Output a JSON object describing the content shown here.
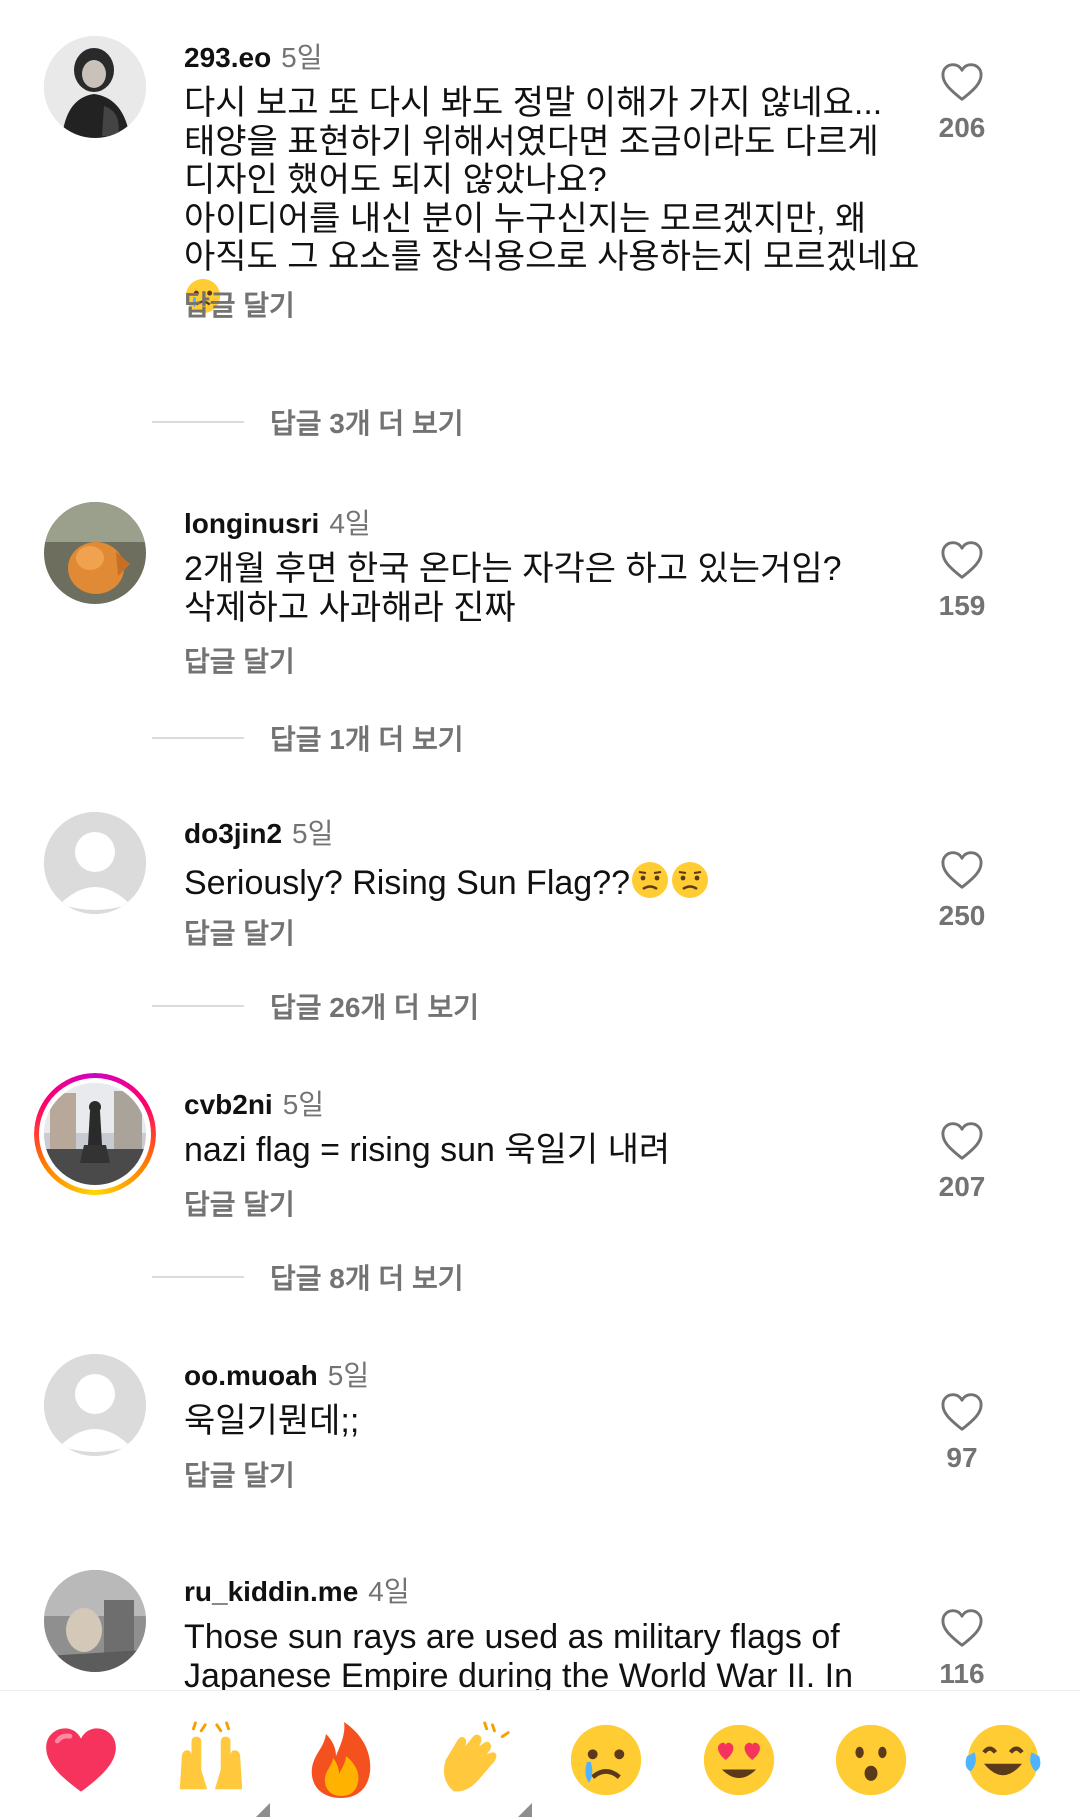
{
  "comments": [
    {
      "username": "293.eo",
      "time": "5일",
      "text": "다시 보고 또 다시 봐도 정말 이해가 가지 않네요...\n태양을 표현하기 위해서였다면 조금이라도 다르게\n디자인 했어도 되지 않았나요?\n아이디어를 내신 분이 누구신지는 모르겠지만, 왜\n아직도 그 요소를 장식용으로 사용하는지 모르겠네요",
      "emoji": "crying-face",
      "reply_label": "답글 달기",
      "likes": "206",
      "more_replies": "답글 3개 더 보기"
    },
    {
      "username": "longinusri",
      "time": "4일",
      "text": "2개월 후면 한국 온다는 자각은 하고 있는거임?\n삭제하고 사과해라 진짜",
      "reply_label": "답글 달기",
      "likes": "159",
      "more_replies": "답글 1개 더 보기"
    },
    {
      "username": "do3jin2",
      "time": "5일",
      "text": "Seriously? Rising Sun Flag??",
      "emoji": "worried-face",
      "reply_label": "답글 달기",
      "likes": "250",
      "more_replies": "답글 26개 더 보기"
    },
    {
      "username": "cvb2ni",
      "time": "5일",
      "text": "nazi flag = rising sun 욱일기 내려",
      "reply_label": "답글 달기",
      "likes": "207",
      "more_replies": "답글 8개 더 보기"
    },
    {
      "username": "oo.muoah",
      "time": "5일",
      "text": "욱일기뭔데;;",
      "reply_label": "답글 달기",
      "likes": "97"
    },
    {
      "username": "ru_kiddin.me",
      "time": "4일",
      "text": "Those sun rays are used as military flags of\nJapanese Empire during the World War II. In",
      "likes": "116"
    }
  ],
  "reaction_bar": [
    "red-heart",
    "raising-hands",
    "fire",
    "clapping-hands",
    "crying-face",
    "heart-eyes-face",
    "surprised-face",
    "tears-of-joy-face"
  ],
  "colors": {
    "text": "#111111",
    "secondary": "#737373",
    "divider": "#dbdbdb",
    "story_ring": [
      "#d300c5",
      "#ff0069",
      "#ff7a00",
      "#ffd600"
    ]
  }
}
